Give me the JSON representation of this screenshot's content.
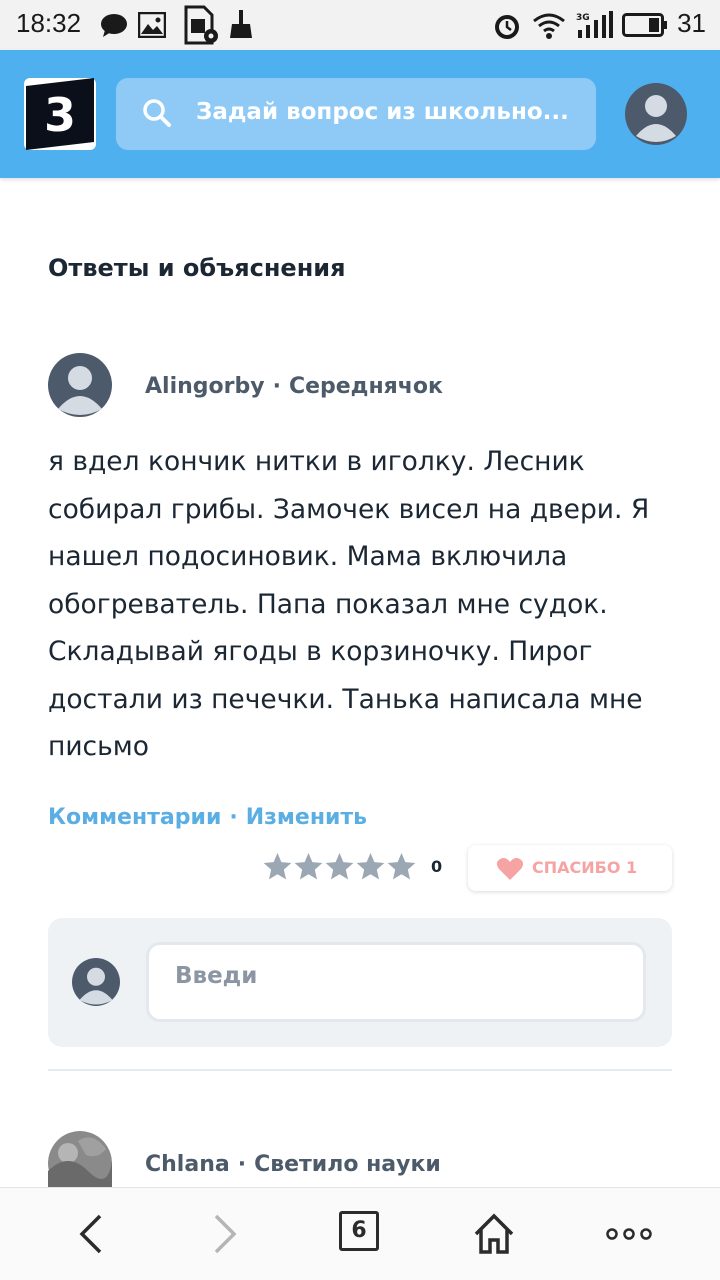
{
  "status_bar": {
    "time": "18:32",
    "battery": "31",
    "icons": [
      "chat-bubble-icon",
      "image-icon",
      "sim-settings-icon",
      "broom-icon",
      "alarm-icon",
      "wifi-icon",
      "signal-icon",
      "battery-icon"
    ],
    "network_type": "3G"
  },
  "header": {
    "logo_text": "3",
    "search_placeholder": "Задай вопрос из школьно...",
    "colors": {
      "bar": "#4fb0f0",
      "search_bg": "#8fcaf6"
    }
  },
  "section": {
    "title": "Ответы и объяснения"
  },
  "answer": {
    "author": "Alingorby",
    "separator": "·",
    "rank": "Середнячок",
    "text": "я вдел кончик нитки в иголку. Лесник собирал грибы. Замочек висел на двери. Я нашел подосиновик. Мама включила обогреватель. Папа показал мне судок. Складывай ягоды в корзиночку. Пирог достали из печечки. Танька написала мне письмо",
    "links": {
      "comments": "Комментарии",
      "edit": "Изменить"
    },
    "rating": {
      "stars": 5,
      "filled": 0,
      "count": "0"
    },
    "thanks": {
      "label": "СПАСИБО 1"
    }
  },
  "comment": {
    "placeholder": "Введи"
  },
  "next_answer": {
    "author": "Chlana",
    "separator": "·",
    "rank": "Светило науки"
  },
  "bottom_bar": {
    "tab_count": "6",
    "icons": [
      "back-arrow-icon",
      "forward-arrow-icon",
      "tabs-icon",
      "home-icon",
      "more-icon"
    ]
  }
}
